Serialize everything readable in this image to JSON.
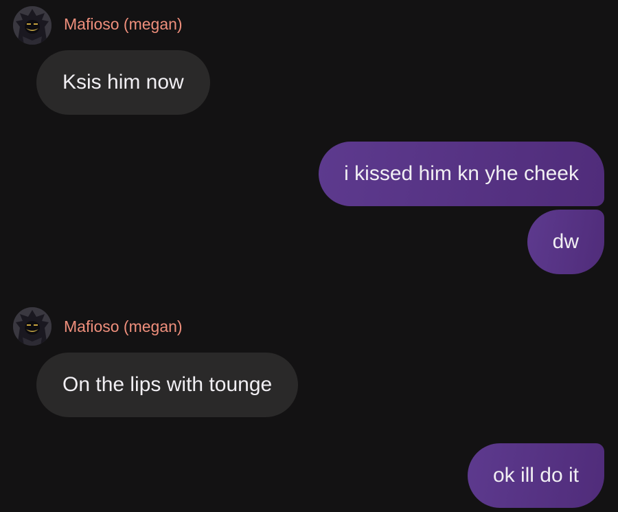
{
  "colors": {
    "background": "#131213",
    "incoming_bubble": "#2a2929",
    "outgoing_bubble": "#55307f",
    "sender_name": "#ef8f7c",
    "message_text": "#f1eff3"
  },
  "messages": [
    {
      "direction": "incoming",
      "sender": "Mafioso (megan)",
      "avatar_icon": "hooded-character-avatar-icon",
      "text": "Ksis him now"
    },
    {
      "direction": "outgoing",
      "text": "i kissed him kn yhe cheek"
    },
    {
      "direction": "outgoing",
      "text": "dw"
    },
    {
      "direction": "incoming",
      "sender": "Mafioso (megan)",
      "avatar_icon": "hooded-character-avatar-icon",
      "text": "On the lips with tounge"
    },
    {
      "direction": "outgoing",
      "text": "ok ill do it"
    }
  ]
}
